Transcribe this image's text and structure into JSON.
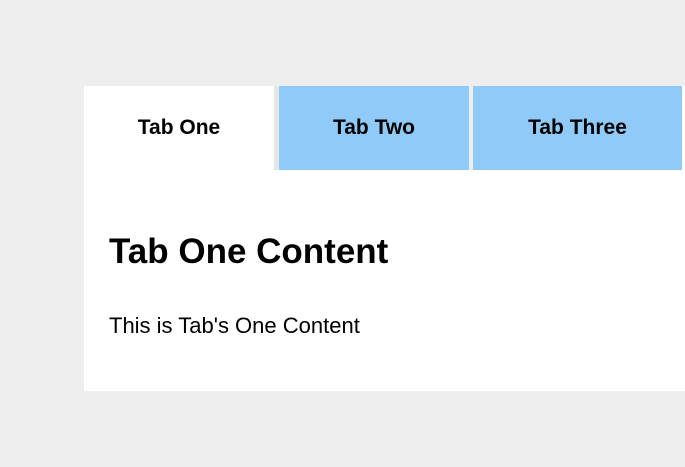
{
  "tabs": [
    {
      "label": "Tab One",
      "active": true
    },
    {
      "label": "Tab Two",
      "active": false
    },
    {
      "label": "Tab Three",
      "active": false
    }
  ],
  "panel": {
    "title": "Tab One Content",
    "text": "This is Tab's One Content"
  },
  "colors": {
    "page_background": "#eeeeee",
    "active_tab": "#ffffff",
    "inactive_tab": "#90caf9",
    "panel_background": "#ffffff",
    "text": "#000000"
  }
}
